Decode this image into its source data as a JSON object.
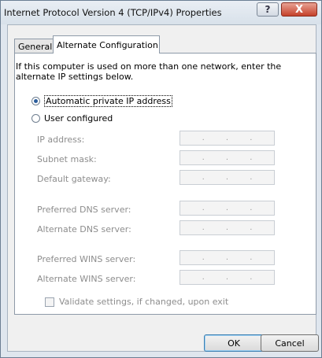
{
  "window": {
    "title": "Internet Protocol Version 4 (TCP/IPv4) Properties",
    "help_glyph": "?",
    "close_glyph": "X"
  },
  "tabs": [
    {
      "label": "General",
      "selected": false
    },
    {
      "label": "Alternate Configuration",
      "selected": true
    }
  ],
  "intro_text": "If this computer is used on more than one network, enter the alternate IP settings below.",
  "options": {
    "automatic": {
      "label": "Automatic private IP address",
      "checked": true
    },
    "user": {
      "label": "User configured",
      "checked": false
    }
  },
  "fields": [
    {
      "label": "IP address:",
      "dots": "."
    },
    {
      "label": "Subnet mask:",
      "dots": "."
    },
    {
      "label": "Default gateway:",
      "dots": "."
    },
    {
      "label": "Preferred DNS server:",
      "dots": "."
    },
    {
      "label": "Alternate DNS server:",
      "dots": "."
    },
    {
      "label": "Preferred WINS server:",
      "dots": "."
    },
    {
      "label": "Alternate WINS server:",
      "dots": "."
    }
  ],
  "validate": {
    "label": "Validate settings, if changed, upon exit",
    "checked": false
  },
  "buttons": {
    "ok": "OK",
    "cancel": "Cancel"
  }
}
